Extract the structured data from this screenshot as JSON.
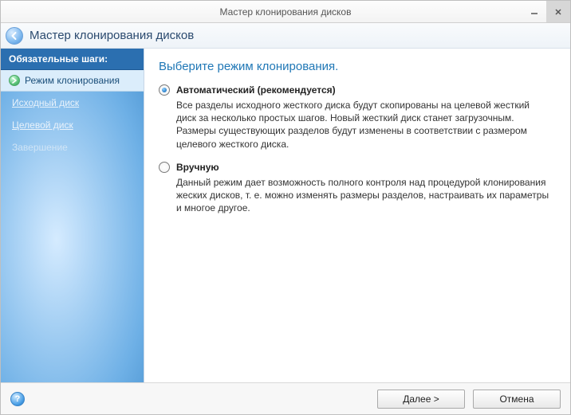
{
  "window": {
    "title": "Мастер клонирования дисков"
  },
  "header": {
    "title": "Мастер клонирования дисков"
  },
  "sidebar": {
    "header": "Обязательные шаги:",
    "active": "Режим клонирования",
    "items": [
      {
        "label": "Исходный диск"
      },
      {
        "label": "Целевой диск"
      },
      {
        "label": "Завершение"
      }
    ]
  },
  "content": {
    "title": "Выберите режим клонирования.",
    "options": [
      {
        "label": "Автоматический (рекомендуется)",
        "checked": true,
        "desc": "Все разделы исходного жесткого диска будут скопированы на целевой жесткий диск за несколько простых шагов. Новый жесткий диск станет загрузочным. Размеры существующих разделов будут изменены в соответствии с размером целевого жесткого диска."
      },
      {
        "label": "Вручную",
        "checked": false,
        "desc": "Данный режим дает возможность полного контроля над процедурой клонирования жеских дисков, т. е. можно изменять размеры разделов, настраивать их параметры и многое другое."
      }
    ]
  },
  "footer": {
    "next": "Далее >",
    "cancel": "Отмена",
    "help": "?"
  }
}
